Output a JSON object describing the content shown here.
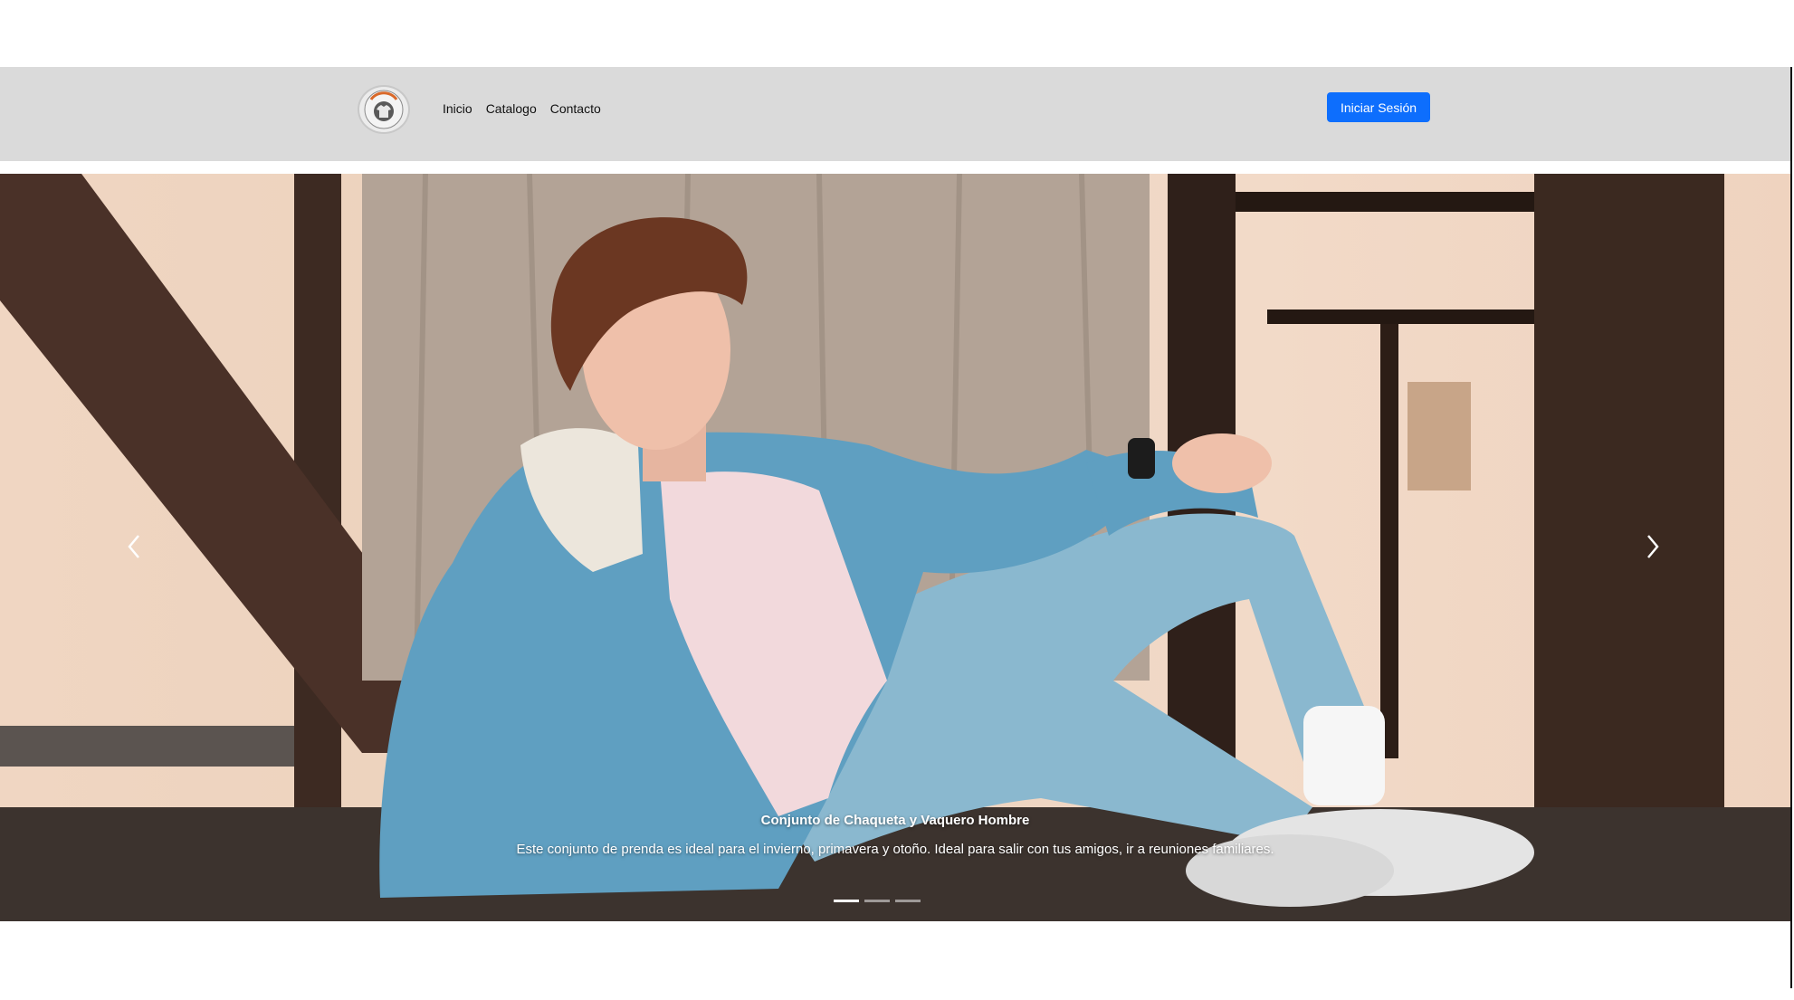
{
  "header": {
    "logo_icon": "tshirt-badge-icon",
    "nav": [
      {
        "label": "Inicio"
      },
      {
        "label": "Catalogo"
      },
      {
        "label": "Contacto"
      }
    ],
    "login_label": "Iniciar Sesión"
  },
  "carousel": {
    "caption_title": "Conjunto de Chaqueta y Vaquero Hombre",
    "caption_text": "Este conjunto de prenda es ideal para el invierno, primavera y otoño. Ideal para salir con tus amigos, ir a reuniones familiares.",
    "slide_count": 3,
    "active_slide": 1,
    "prev_icon": "chevron-left-icon",
    "next_icon": "chevron-right-icon"
  },
  "colors": {
    "navbar_bg": "#dadada",
    "accent": "#0d6efd"
  }
}
